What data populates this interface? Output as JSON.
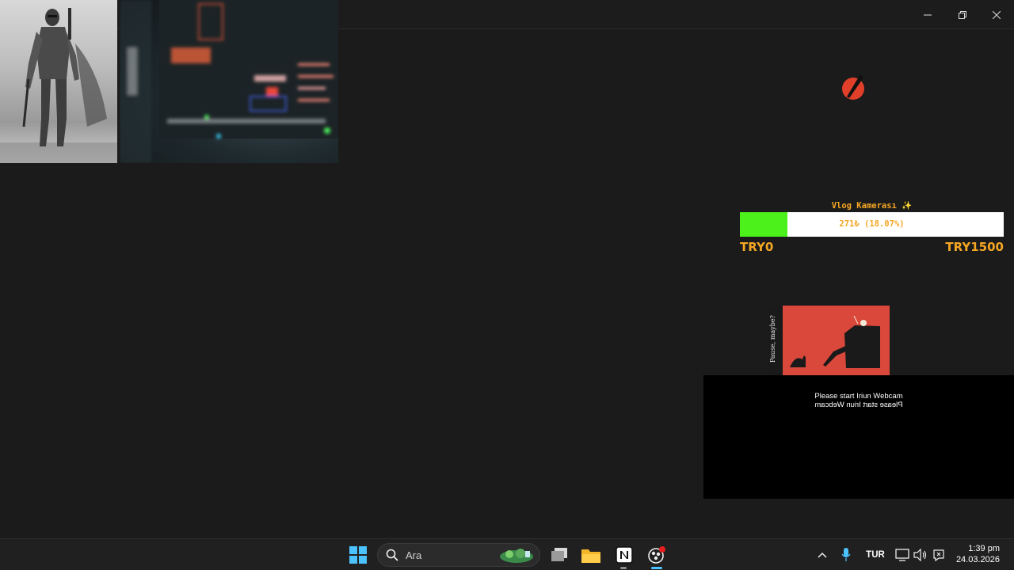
{
  "window": {
    "controls": [
      "minimize",
      "restore",
      "close"
    ]
  },
  "images": {
    "left": "mandalorian-sketch",
    "right": "blurred-monitor-photo"
  },
  "goal": {
    "title": "Vlog Kamerası ✨",
    "progress_text": "271₺ (18.07%)",
    "progress": 0.1807,
    "min_label": "TRY0",
    "max_label": "TRY1500",
    "fill_color": "#4cf01a",
    "text_color": "#f5a623"
  },
  "poster": {
    "side_text": "Pause, maybe?"
  },
  "webcam": {
    "message": "Please start Iriun Webcam",
    "message_mirrored": "Please start Iriun Webcam"
  },
  "taskbar": {
    "search_placeholder": "Ara",
    "language": "TUR",
    "time": "1:39 pm",
    "date": "24.03.2026"
  }
}
